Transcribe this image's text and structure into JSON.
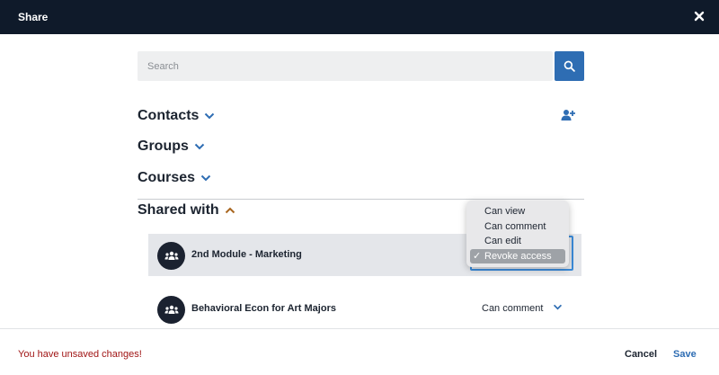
{
  "dialog": {
    "title": "Share"
  },
  "search": {
    "placeholder": "Search"
  },
  "sections": {
    "contacts": "Contacts",
    "groups": "Groups",
    "courses": "Courses",
    "shared_with": "Shared with"
  },
  "shared": [
    {
      "name": "2nd Module - Marketing",
      "permission": ""
    },
    {
      "name": "Behavioral Econ for Art Majors",
      "permission": "Can comment"
    }
  ],
  "permission_menu": {
    "options": [
      "Can view",
      "Can comment",
      "Can edit",
      "Revoke access"
    ],
    "selected": "Revoke access",
    "check_mark": "✓"
  },
  "footer": {
    "unsaved": "You have unsaved changes!",
    "cancel": "Cancel",
    "save": "Save"
  },
  "colors": {
    "header_bg": "#0f1a2a",
    "accent": "#2e6db3",
    "section_chevron": "#2e6db3",
    "expanded_chevron": "#a8651e",
    "warning": "#a01515"
  },
  "icons": {
    "close": "close-icon",
    "search": "search-icon",
    "add_contact": "add-person-icon",
    "group_avatar": "group-icon"
  }
}
